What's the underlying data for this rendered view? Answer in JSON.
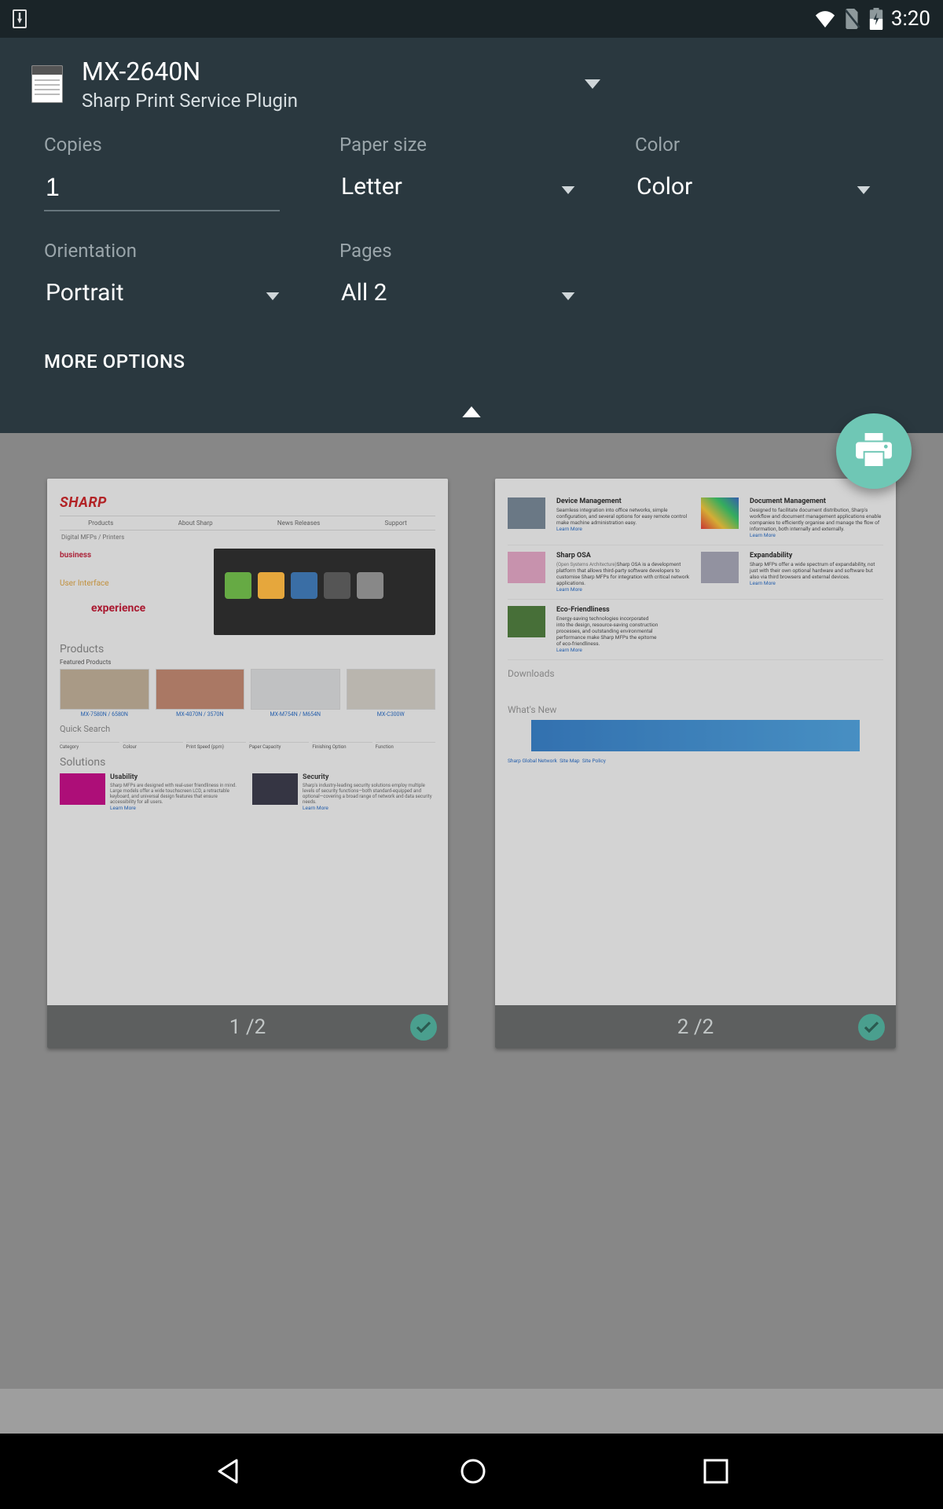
{
  "statusbar": {
    "time": "3:20"
  },
  "printer": {
    "name": "MX-2640N",
    "service": "Sharp Print Service Plugin"
  },
  "options": {
    "copies": {
      "label": "Copies",
      "value": "1"
    },
    "paper_size": {
      "label": "Paper size",
      "value": "Letter"
    },
    "color": {
      "label": "Color",
      "value": "Color"
    },
    "orientation": {
      "label": "Orientation",
      "value": "Portrait"
    },
    "pages": {
      "label": "Pages",
      "value": "All 2"
    }
  },
  "more_options": "MORE OPTIONS",
  "preview": {
    "page1": {
      "indicator": "1 /2",
      "logo": "SHARP"
    },
    "page2": {
      "indicator": "2 /2"
    }
  },
  "sheet1": {
    "nav": [
      "Products",
      "About Sharp",
      "News Releases",
      "Support"
    ],
    "crumb": "Digital MFPs / Printers",
    "hero": {
      "business": "business",
      "ui": "User Interface",
      "exp": "experience"
    },
    "products_title": "Products",
    "featured_label": "Featured Products",
    "quick_title": "Quick Search",
    "quick_cols": [
      "Category",
      "Colour",
      "Print Speed (ppm)",
      "Paper Capacity",
      "Finishing Option",
      "Function"
    ],
    "solutions_title": "Solutions",
    "solutions": [
      {
        "h": "Usability",
        "t": "Sharp MFPs are designed with real-user friendliness in mind. Large models offer a wide touchscreen LCD, a retractable keyboard, and universal design features that ensure accessibility for all users.",
        "lm": "Learn More"
      },
      {
        "h": "Security",
        "t": "Sharp's industry-leading security solutions employ multiple levels of security functions—both standard-equipped and optional—covering a broad range of network and data security needs.",
        "lm": "Learn More"
      }
    ]
  },
  "sheet2": {
    "items": [
      {
        "h": "Device Management",
        "t": "Seamless integration into office networks, simple configuration, and several options for easy remote control make machine administration easy.",
        "lm": "Learn More"
      },
      {
        "h": "Document Management",
        "t": "Designed to facilitate document distribution, Sharp's workflow and document management applications enable companies to efficiently organise and manage the flow of information, both internally and externally.",
        "lm": "Learn More"
      },
      {
        "h": "Sharp OSA",
        "sub": "(Open Systems Architecture)",
        "t": "Sharp OSA is a development platform that allows third-party software developers to customise Sharp MFPs for integration with critical network applications.",
        "lm": "Learn More"
      },
      {
        "h": "Expandability",
        "t": "Sharp MFPs offer a wide spectrum of expandability, not just with their own optional hardware and software but also via third browsers and external devices.",
        "lm": "Learn More"
      },
      {
        "h": "Eco-Friendliness",
        "t": "Energy-saving technologies incorporated into the design, resource-saving construction processes, and outstanding environmental performance make Sharp MFPs the epitome of eco-friendliness.",
        "lm": "Learn More"
      }
    ],
    "downloads_title": "Downloads",
    "whats_new": "What's New",
    "footer_links": [
      "Sharp Global Network",
      "Site Map",
      "Site Policy"
    ]
  }
}
